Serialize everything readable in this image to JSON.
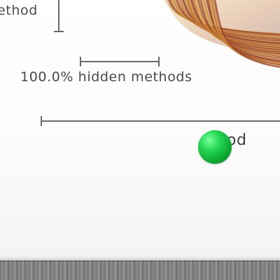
{
  "figure": {
    "top_label": "ethod",
    "hidden_label": "100.0% hidden methods",
    "right_label": "ethod"
  },
  "cursor": {
    "color": "#1ec94a"
  },
  "colors": {
    "fan_dark": "#8a3a24",
    "fan_mid": "#c0722e",
    "fan_light": "#e2b152",
    "text": "#4a4a4a",
    "scale": "#6a6a6a",
    "floor": "#808080"
  }
}
